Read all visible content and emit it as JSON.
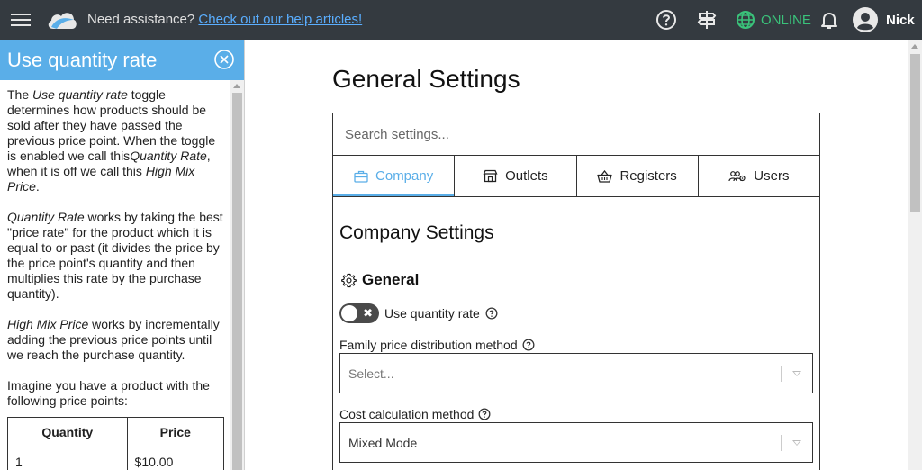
{
  "topbar": {
    "assist_text": "Need assistance?",
    "assist_link": "Check out our help articles!",
    "status": "ONLINE",
    "user_name": "Nick",
    "icons": [
      "menu-icon",
      "cloud-logo-icon",
      "help-circle-icon",
      "signpost-icon",
      "globe-icon",
      "bell-icon",
      "user-avatar-icon"
    ],
    "status_color": "#3ac27a",
    "link_color": "#5aaeff",
    "bar_color": "#343a40"
  },
  "help_panel": {
    "title": "Use quantity rate",
    "header_color": "#5aaee8",
    "p1": {
      "a": "The ",
      "b": "Use quantity rate",
      "c": " toggle determines how products should be sold after they have passed the previous price point. When the toggle is enabled we call this",
      "d": "Quantity Rate",
      "e": ", when it is off we call this ",
      "f": "High Mix Price",
      "g": "."
    },
    "p2": {
      "a": "Quantity Rate",
      "b": " works by taking the best \"price rate\" for the product which it is equal to or past (it divides the price by the price point's quantity and then multiplies this rate by the purchase quantity)."
    },
    "p3": {
      "a": "High Mix Price",
      "b": " works by incrementally adding the previous price points until we reach the purchase quantity."
    },
    "p4": "Imagine you have a product with the following price points:",
    "table": {
      "headers": [
        "Quantity",
        "Price"
      ],
      "rows": [
        [
          "1",
          "$10.00"
        ]
      ]
    }
  },
  "main": {
    "page_title": "General Settings",
    "search_placeholder": "Search settings...",
    "tabs": [
      {
        "label": "Company",
        "icon": "briefcase-icon",
        "active": true
      },
      {
        "label": "Outlets",
        "icon": "store-icon",
        "active": false
      },
      {
        "label": "Registers",
        "icon": "basket-icon",
        "active": false
      },
      {
        "label": "Users",
        "icon": "users-icon",
        "active": false
      }
    ],
    "company_title": "Company Settings",
    "section_title": "General",
    "toggle_label": "Use quantity rate",
    "toggle_on": false,
    "fields": [
      {
        "label": "Family price distribution method",
        "value": "Select...",
        "placeholder": true
      },
      {
        "label": "Cost calculation method",
        "value": "Mixed Mode",
        "placeholder": false
      }
    ],
    "accent_color": "#5aaee8"
  }
}
